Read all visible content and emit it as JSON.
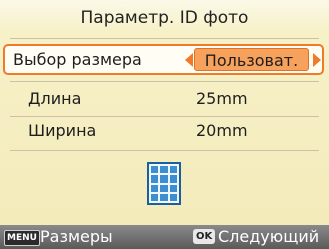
{
  "title": "Параметр. ID фото",
  "rows": [
    {
      "label": "Выбор размера",
      "value": "Пользоват."
    },
    {
      "label": "Длина",
      "value": "25mm"
    },
    {
      "label": "Ширина",
      "value": "20mm"
    }
  ],
  "footer": {
    "menu_key": "MENU",
    "menu_label": "Размеры",
    "ok_key": "OK",
    "ok_label": "Следующий"
  },
  "colors": {
    "accent": "#f07a2a",
    "selected_fill": "#f7a25c",
    "icon_blue": "#3e8fd1"
  },
  "icons": {
    "photo_layout": "photo-grid-icon"
  }
}
